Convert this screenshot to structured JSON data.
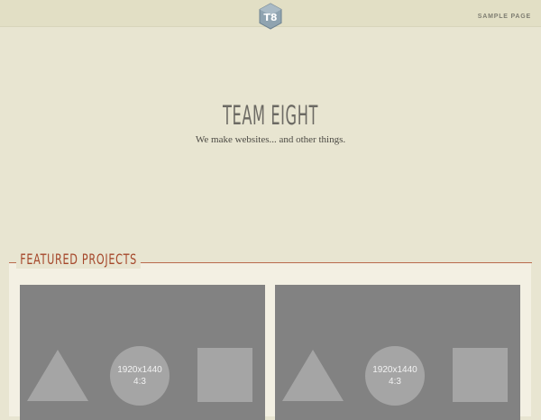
{
  "header": {
    "logo_text": "T8",
    "nav_link": "SAMPLE PAGE"
  },
  "hero": {
    "title": "TEAM EIGHT",
    "tagline": "We make websites... and other things."
  },
  "featured": {
    "heading": "FEATURED PROJECTS",
    "projects": [
      {
        "placeholder_size": "1920x1440",
        "placeholder_ratio": "4:3"
      },
      {
        "placeholder_size": "1920x1440",
        "placeholder_ratio": "4:3"
      }
    ]
  },
  "colors": {
    "background": "#e8e5d1",
    "accent": "#a5472a",
    "placeholder": "#828282"
  }
}
